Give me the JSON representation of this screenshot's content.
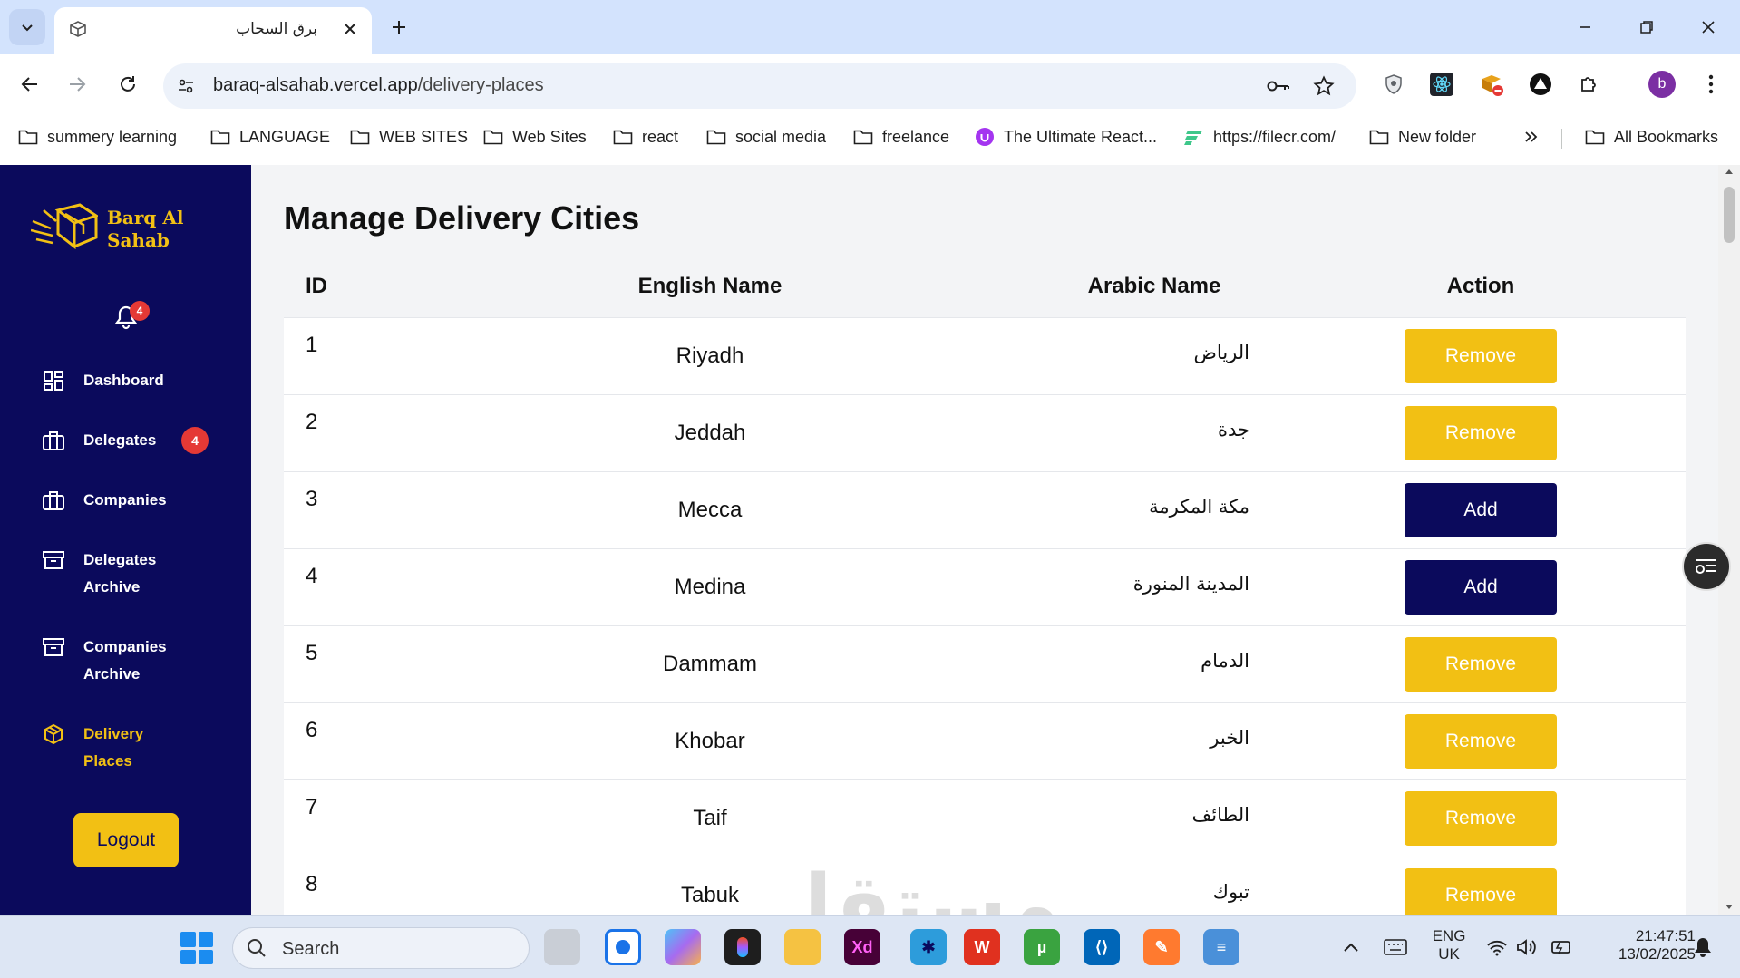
{
  "browser": {
    "tab_title": "برق السحاب",
    "url_host": "baraq-alsahab.vercel.app",
    "url_path": "/delivery-places",
    "profile_initial": "b",
    "bookmarks": [
      {
        "label": "summery learning",
        "icon": "folder-icon"
      },
      {
        "label": "LANGUAGE",
        "icon": "folder-icon"
      },
      {
        "label": "WEB SITES",
        "icon": "folder-icon"
      },
      {
        "label": "Web Sites",
        "icon": "folder-icon"
      },
      {
        "label": "react",
        "icon": "folder-icon"
      },
      {
        "label": "social media",
        "icon": "folder-icon"
      },
      {
        "label": "freelance",
        "icon": "folder-icon"
      },
      {
        "label": "The Ultimate React...",
        "icon": "udemy-icon"
      },
      {
        "label": "https://filecr.com/",
        "icon": "filecr-icon"
      },
      {
        "label": "New folder",
        "icon": "folder-icon"
      }
    ],
    "all_bookmarks": "All Bookmarks"
  },
  "sidebar": {
    "brand_line1": "Barq Al",
    "brand_line2": "Sahab",
    "notification_count": "4",
    "items": [
      {
        "line1": "Dashboard",
        "line2": ""
      },
      {
        "line1": "Delegates",
        "line2": ""
      },
      {
        "line1": "Companies",
        "line2": ""
      },
      {
        "line1": "Delegates",
        "line2": "Archive"
      },
      {
        "line1": "Companies",
        "line2": "Archive"
      },
      {
        "line1": "Delivery",
        "line2": "Places"
      }
    ],
    "delegates_badge": "4",
    "logout_label": "Logout",
    "active_color": "#f2c014",
    "bg_color": "#0b0a5c"
  },
  "main": {
    "title": "Manage Delivery Cities",
    "columns": {
      "id": "ID",
      "english": "English Name",
      "arabic": "Arabic Name",
      "action": "Action"
    },
    "rows": [
      {
        "id": "1",
        "en": "Riyadh",
        "ar": "الرياض",
        "action": "Remove"
      },
      {
        "id": "2",
        "en": "Jeddah",
        "ar": "جدة",
        "action": "Remove"
      },
      {
        "id": "3",
        "en": "Mecca",
        "ar": "مكة المكرمة",
        "action": "Add"
      },
      {
        "id": "4",
        "en": "Medina",
        "ar": "المدينة المنورة",
        "action": "Add"
      },
      {
        "id": "5",
        "en": "Dammam",
        "ar": "الدمام",
        "action": "Remove"
      },
      {
        "id": "6",
        "en": "Khobar",
        "ar": "الخبر",
        "action": "Remove"
      },
      {
        "id": "7",
        "en": "Taif",
        "ar": "الطائف",
        "action": "Remove"
      },
      {
        "id": "8",
        "en": "Tabuk",
        "ar": "تبوك",
        "action": "Remove"
      }
    ]
  },
  "watermark": "مستقل",
  "taskbar": {
    "search_label": "Search",
    "lang_line1": "ENG",
    "lang_line2": "UK",
    "time": "21:47:51",
    "date": "13/02/2025"
  }
}
